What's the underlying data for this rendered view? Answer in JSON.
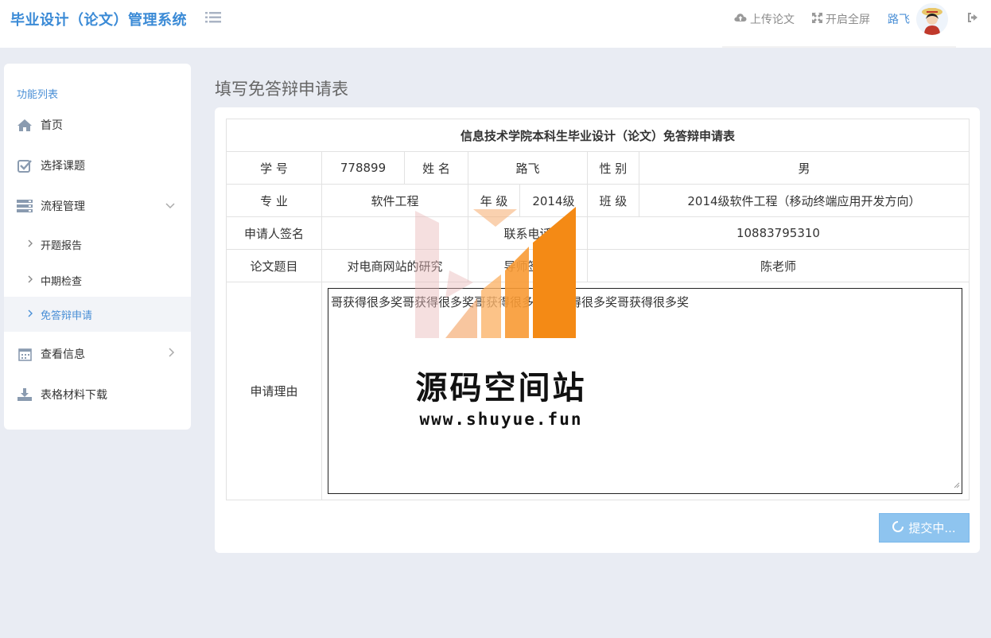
{
  "header": {
    "brand": "毕业设计（论文）管理系统",
    "upload_label": "上传论文",
    "fullscreen_label": "开启全屏",
    "user_name": "路飞"
  },
  "sidebar": {
    "title": "功能列表",
    "items": [
      {
        "label": "首页",
        "icon": "home-icon"
      },
      {
        "label": "选择课题",
        "icon": "checkbox-icon"
      },
      {
        "label": "流程管理",
        "icon": "server-icon"
      },
      {
        "label": "查看信息",
        "icon": "calendar-icon"
      },
      {
        "label": "表格材料下载",
        "icon": "download-icon"
      }
    ],
    "subitems": [
      {
        "label": "开题报告"
      },
      {
        "label": "中期检查"
      },
      {
        "label": "免答辩申请"
      }
    ]
  },
  "page": {
    "title": "填写免答辩申请表"
  },
  "form": {
    "table_title": "信息技术学院本科生毕业设计（论文）免答辩申请表",
    "labels": {
      "student_id": "学 号",
      "name": "姓 名",
      "gender": "性 别",
      "major": "专 业",
      "grade": "年 级",
      "class": "班 级",
      "signature": "申请人签名",
      "phone": "联系电话",
      "topic": "论文题目",
      "advisor": "导师签名",
      "reason": "申请理由"
    },
    "values": {
      "student_id": "778899",
      "name": "路飞",
      "gender": "男",
      "major": "软件工程",
      "grade": "2014级",
      "class": "2014级软件工程（移动终端应用开发方向）",
      "signature": "",
      "phone": "10883795310",
      "topic": "对电商网站的研究",
      "advisor": "陈老师",
      "reason": "哥获得很多奖哥获得很多奖哥获得很多奖哥获得很多奖哥获得很多奖"
    },
    "submit_label": "提交中..."
  },
  "watermark": {
    "text": "源码空间站",
    "url": "www.shuyue.fun"
  },
  "colors": {
    "accent": "#4a8fd6",
    "background": "#e9ecf3",
    "submit": "#8ec4ef"
  }
}
